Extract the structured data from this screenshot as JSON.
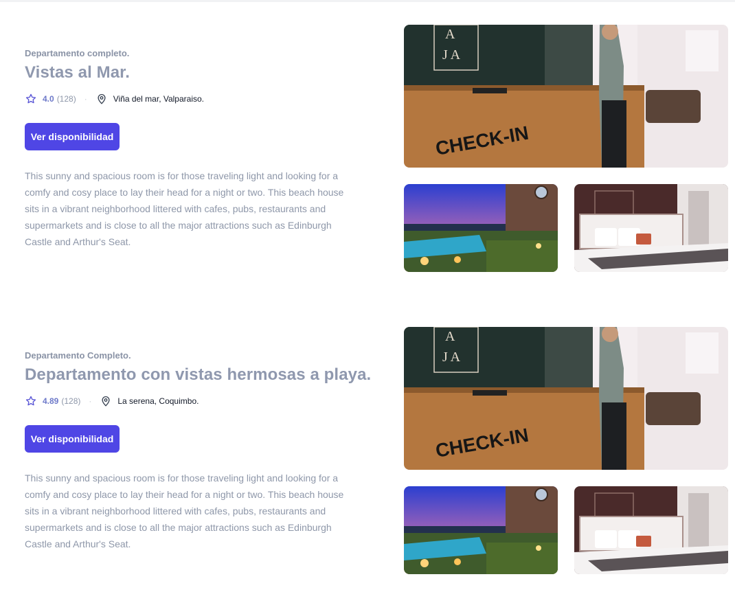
{
  "listings": [
    {
      "eyebrow": "Departamento completo.",
      "title": "Vistas al Mar.",
      "rating": "4.0",
      "reviews": "(128)",
      "separator": "·",
      "location": "Viña del mar, Valparaiso.",
      "button": "Ver disponibilidad",
      "description": "This sunny and spacious room is for those traveling light and looking for a comfy and cosy place to lay their head for a night or two. This beach house sits in a vibrant neighborhood littered with cafes, pubs, restaurants and supermarkets and is close to all the major attractions such as Edinburgh Castle and Arthur's Seat.",
      "photos": {
        "main_sign": "CHECK-IN",
        "wall_letters": [
          "A",
          "J A"
        ]
      }
    },
    {
      "eyebrow": "Departamento Completo.",
      "title": "Departamento con vistas hermosas a playa.",
      "rating": "4.89",
      "reviews": "(128)",
      "separator": "·",
      "location": "La serena, Coquimbo.",
      "button": "Ver disponibilidad",
      "description": "This sunny and spacious room is for those traveling light and looking for a comfy and cosy place to lay their head for a night or two. This beach house sits in a vibrant neighborhood littered with cafes, pubs, restaurants and supermarkets and is close to all the major attractions such as Edinburgh Castle and Arthur's Seat.",
      "photos": {
        "main_sign": "CHECK-IN",
        "wall_letters": [
          "A",
          "J A"
        ]
      }
    }
  ],
  "icons": {
    "rating": "star-icon",
    "location": "map-pin-icon"
  },
  "colors": {
    "accent": "#4f46e5",
    "rating": "#6d79c9",
    "muted_text": "#8e97a9",
    "title": "#8f98ae"
  }
}
